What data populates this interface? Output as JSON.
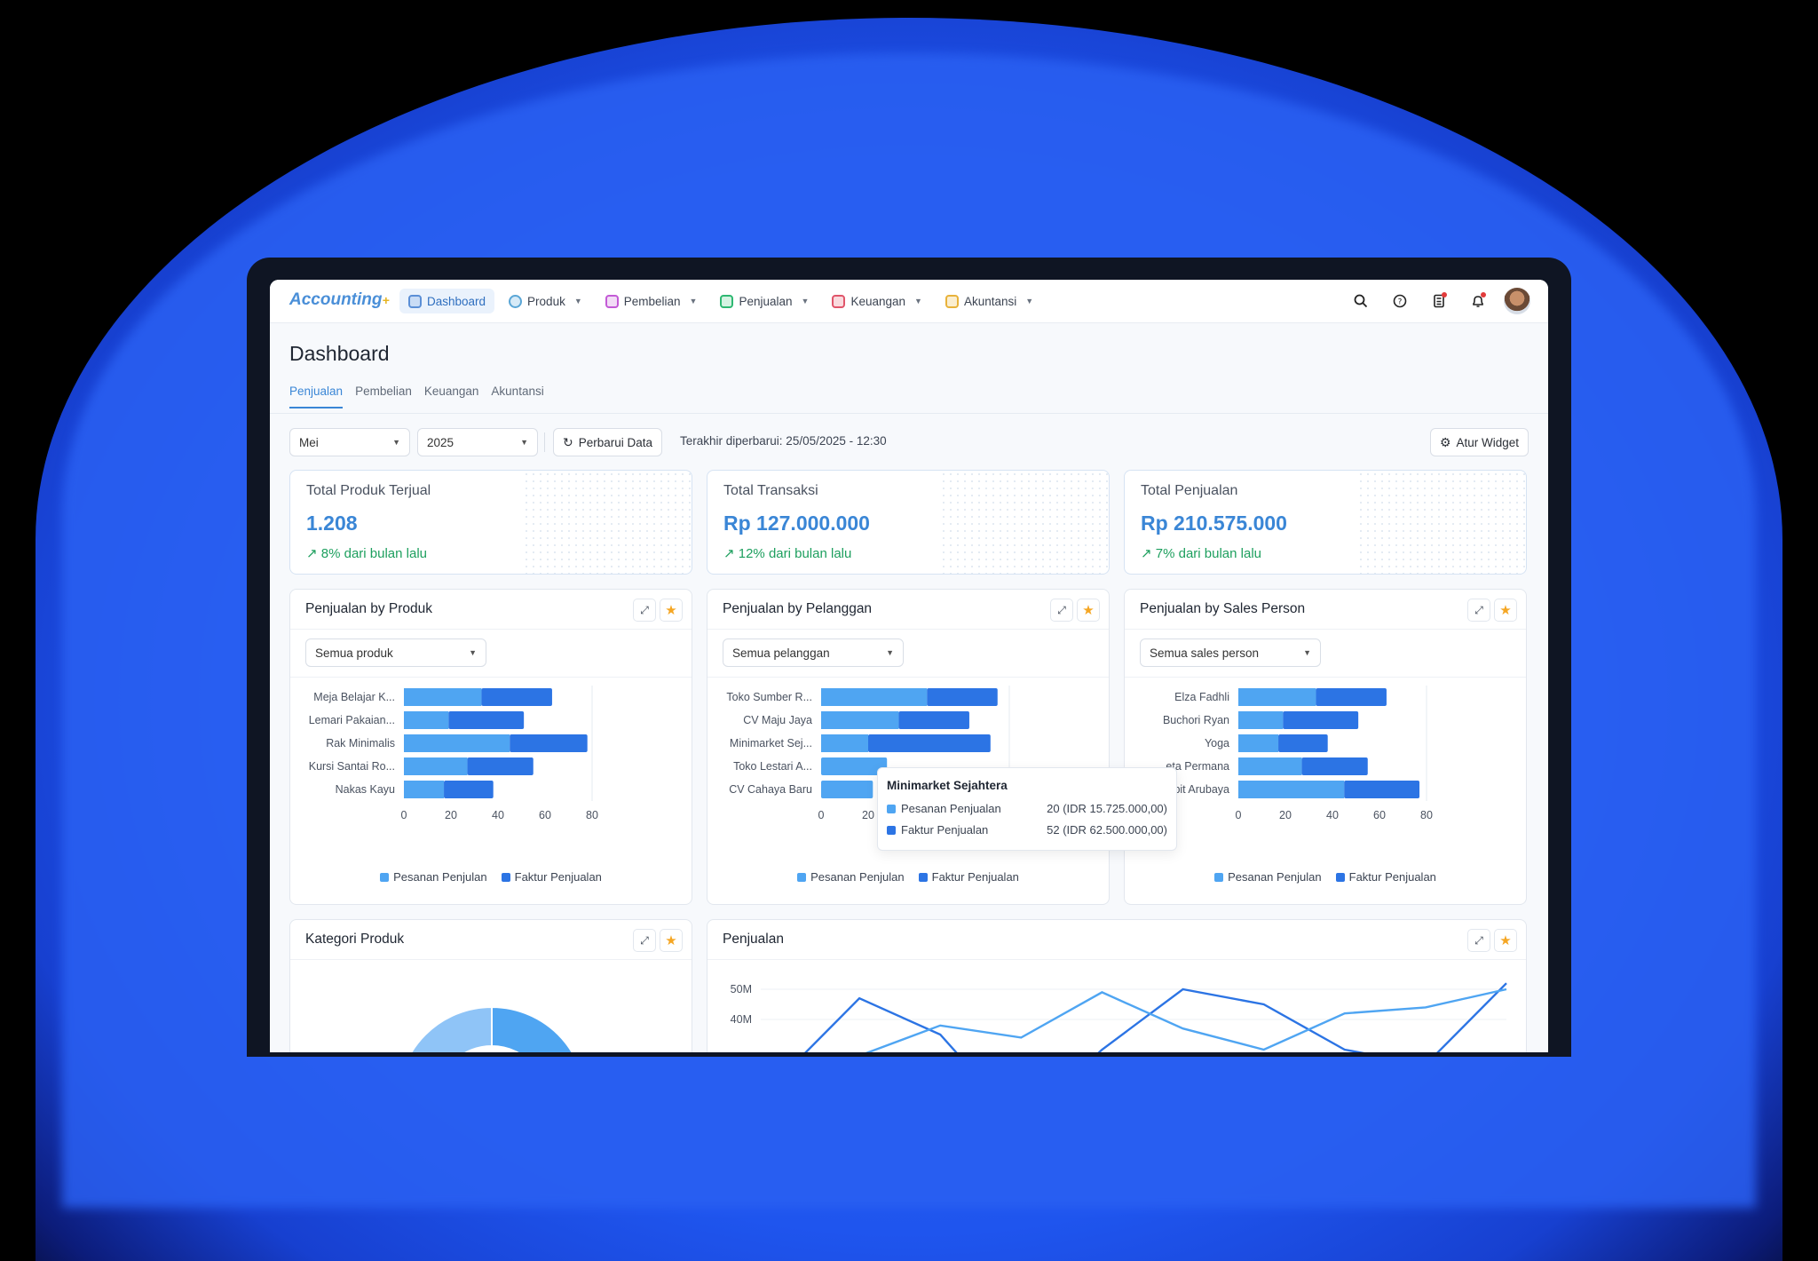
{
  "app": {
    "logo": "Accounting",
    "logo_mark": "+"
  },
  "nav": {
    "items": [
      {
        "label": "Dashboard",
        "color": "#5b8fd6"
      },
      {
        "label": "Produk",
        "color": "#5aa6d6"
      },
      {
        "label": "Pembelian",
        "color": "#c35ad6"
      },
      {
        "label": "Penjualan",
        "color": "#2eb872"
      },
      {
        "label": "Keuangan",
        "color": "#e0556a"
      },
      {
        "label": "Akuntansi",
        "color": "#e8b23a"
      }
    ]
  },
  "page": {
    "title": "Dashboard",
    "tabs": [
      "Penjualan",
      "Pembelian",
      "Keuangan",
      "Akuntansi"
    ]
  },
  "toolbar": {
    "month": "Mei",
    "year": "2025",
    "refresh_label": "Perbarui Data",
    "updated_text": "Terakhir diperbarui: 25/05/2025 - 12:30",
    "widget_label": "Atur Widget"
  },
  "stats": [
    {
      "label": "Total Produk Terjual",
      "value": "1.208",
      "change": "8% dari bulan lalu"
    },
    {
      "label": "Total Transaksi",
      "value": "Rp 127.000.000",
      "change": "12% dari bulan lalu"
    },
    {
      "label": "Total Penjualan",
      "value": "Rp 210.575.000",
      "change": "7% dari bulan lalu"
    }
  ],
  "widgets": {
    "produk": {
      "title": "Penjualan by Produk",
      "filter": "Semua produk"
    },
    "pelanggan": {
      "title": "Penjualan by Pelanggan",
      "filter": "Semua pelanggan"
    },
    "sales": {
      "title": "Penjualan by Sales Person",
      "filter": "Semua sales person"
    },
    "kategori": {
      "title": "Kategori Produk"
    },
    "penjualan": {
      "title": "Penjualan"
    }
  },
  "legend": {
    "a": "Pesanan Penjulan",
    "b": "Faktur Penjualan"
  },
  "colors": {
    "light": "#4fa5f2",
    "dark": "#2c74e4",
    "accent": "#3a86d6"
  },
  "tooltip": {
    "title": "Minimarket Sejahtera",
    "rows": [
      {
        "label": "Pesanan Penjualan",
        "value": "20 (IDR 15.725.000,00)"
      },
      {
        "label": "Faktur Penjualan",
        "value": "52 (IDR 62.500.000,00)"
      }
    ]
  },
  "chart_data": [
    {
      "type": "bar",
      "orientation": "horizontal",
      "stacked": true,
      "categories": [
        "Meja Belajar K...",
        "Lemari Pakaian...",
        "Rak Minimalis",
        "Kursi Santai Ro...",
        "Nakas Kayu"
      ],
      "series": [
        {
          "name": "Pesanan Penjulan",
          "values": [
            33,
            19,
            45,
            27,
            17
          ]
        },
        {
          "name": "Faktur Penjualan",
          "values": [
            30,
            32,
            33,
            28,
            21
          ]
        }
      ],
      "xticks": [
        "0",
        "20",
        "40",
        "60",
        "80"
      ],
      "xlim": [
        0,
        80
      ]
    },
    {
      "type": "bar",
      "orientation": "horizontal",
      "stacked": true,
      "categories": [
        "Toko Sumber R...",
        "CV Maju Jaya",
        "Minimarket Sej...",
        "Toko Lestari A...",
        "CV Cahaya Baru"
      ],
      "series": [
        {
          "name": "Pesanan Penjulan",
          "values": [
            45,
            33,
            20,
            28,
            22
          ]
        },
        {
          "name": "Faktur Penjualan",
          "values": [
            30,
            30,
            52,
            0,
            0
          ]
        }
      ],
      "xticks": [
        "0",
        "20",
        "40",
        "60",
        "80"
      ],
      "xlim": [
        0,
        80
      ]
    },
    {
      "type": "bar",
      "orientation": "horizontal",
      "stacked": true,
      "categories": [
        "Elza Fadhli",
        "Buchori Ryan",
        "Yoga",
        "...eta Permana",
        "...bit Arubaya"
      ],
      "series": [
        {
          "name": "Pesanan Penjulan",
          "values": [
            33,
            19,
            17,
            27,
            45
          ]
        },
        {
          "name": "Faktur Penjualan",
          "values": [
            30,
            32,
            21,
            28,
            32
          ]
        }
      ],
      "xticks": [
        "0",
        "20",
        "40",
        "60",
        "80"
      ],
      "xlim": [
        0,
        80
      ]
    },
    {
      "type": "line",
      "yticks": [
        "50M",
        "40M"
      ],
      "series": [
        {
          "values": [
            20,
            47,
            35,
            5,
            30,
            50,
            45,
            30,
            25,
            52
          ]
        },
        {
          "values": [
            10,
            28,
            38,
            34,
            49,
            37,
            30,
            42,
            44,
            50
          ]
        }
      ]
    },
    {
      "type": "pie",
      "values": [
        30,
        45,
        25
      ]
    }
  ]
}
